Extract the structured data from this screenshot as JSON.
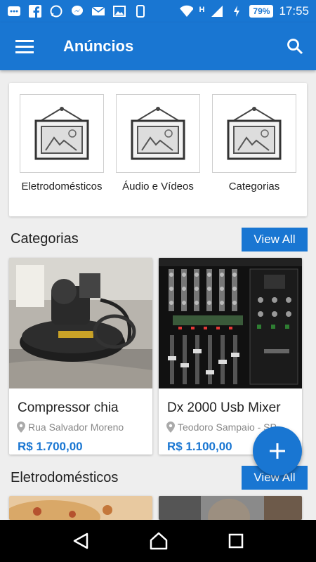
{
  "status_bar": {
    "battery": "79%",
    "time": "17:55",
    "network": "H"
  },
  "app_bar": {
    "title": "Anúncios"
  },
  "categories_strip": [
    {
      "label": "Eletrodomésticos"
    },
    {
      "label": "Áudio e Vídeos"
    },
    {
      "label": "Categorias"
    }
  ],
  "section_categorias": {
    "title": "Categorias",
    "view_all": "View All"
  },
  "products": [
    {
      "name": "Compressor chia",
      "location": "Rua Salvador Moreno",
      "price": "R$ 1.700,00"
    },
    {
      "name": "Dx 2000 Usb Mixer",
      "location": "Teodoro Sampaio - SP,",
      "price": "R$ 1.100,00"
    }
  ],
  "section_eletro": {
    "title": "Eletrodomésticos",
    "view_all": "View All"
  },
  "colors": {
    "primary": "#1976d2",
    "background": "#eeeeee"
  }
}
